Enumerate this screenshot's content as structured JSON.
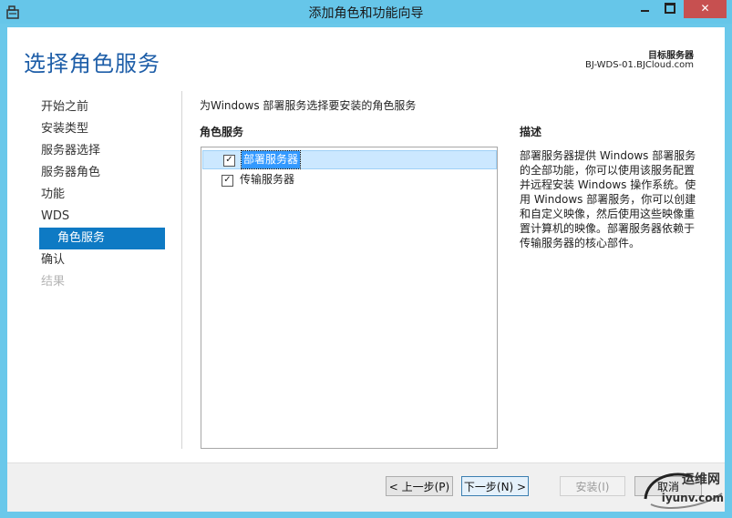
{
  "window": {
    "title": "添加角色和功能向导",
    "close_label": "✕"
  },
  "header": {
    "page_title": "选择角色服务",
    "destination_label": "目标服务器",
    "destination_server": "BJ-WDS-01.BJCloud.com"
  },
  "nav": {
    "items": [
      {
        "label": "开始之前",
        "state": "normal"
      },
      {
        "label": "安装类型",
        "state": "normal"
      },
      {
        "label": "服务器选择",
        "state": "normal"
      },
      {
        "label": "服务器角色",
        "state": "normal"
      },
      {
        "label": "功能",
        "state": "normal"
      },
      {
        "label": "WDS",
        "state": "normal"
      },
      {
        "label": "角色服务",
        "state": "active"
      },
      {
        "label": "确认",
        "state": "normal"
      },
      {
        "label": "结果",
        "state": "disabled"
      }
    ]
  },
  "main": {
    "instruction": "为Windows 部署服务选择要安装的角色服务",
    "column_header": "角色服务",
    "role_services": [
      {
        "label": "部署服务器",
        "checked": true,
        "selected": true
      },
      {
        "label": "传输服务器",
        "checked": true,
        "selected": false
      }
    ],
    "check_mark": "✓",
    "description_header": "描述",
    "description": "部署服务器提供 Windows 部署服务的全部功能，你可以使用该服务配置并远程安装 Windows 操作系统。使用 Windows 部署服务，你可以创建和自定义映像，然后使用这些映像重置计算机的映像。部署服务器依赖于传输服务器的核心部件。"
  },
  "footer": {
    "prev_label": "< 上一步(P)",
    "next_label": "下一步(N) >",
    "install_label": "安装(I)",
    "cancel_label": "取消"
  },
  "watermark": {
    "text1": "运维网",
    "text2": "iyunv.com"
  },
  "colors": {
    "titlebar": "#66c6e9",
    "accent": "#0e7ac4",
    "title_text": "#1e5ea8",
    "close_button": "#c75050"
  }
}
